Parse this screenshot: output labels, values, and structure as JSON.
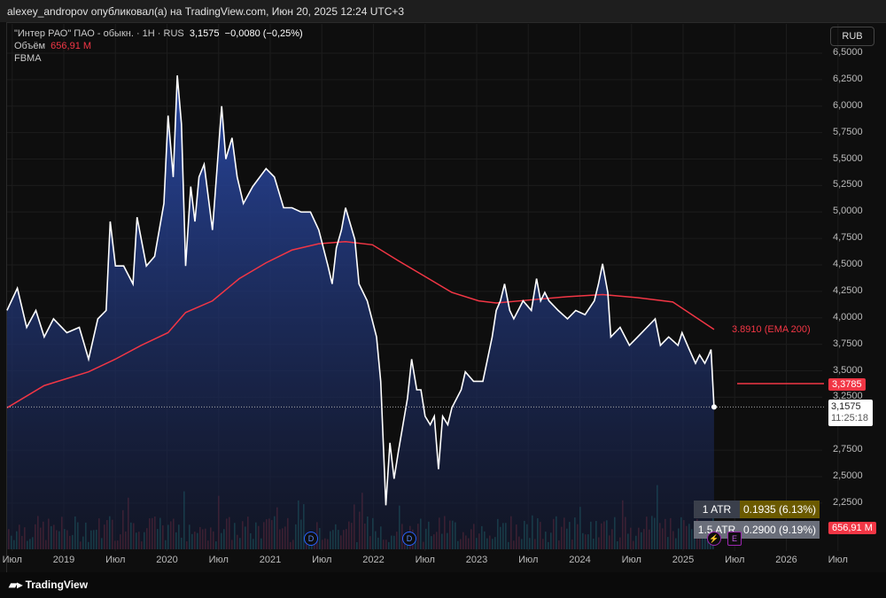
{
  "header": {
    "published": "alexey_andropov опубликовал(а) на TradingView.com, Июн 20, 2025 12:24 UTC+3"
  },
  "legend": {
    "symbol": "\"Интер РАО\" ПАО - обыкн. · 1H · RUS",
    "price": "3,1575",
    "change": "−0,0080 (−0,25%)",
    "volume_label": "Объём",
    "volume_value": "656,91 M",
    "indicator": "FBMA"
  },
  "currency": "RUB",
  "price_axis": [
    "6,5000",
    "6,2500",
    "6,0000",
    "5,7500",
    "5,5000",
    "5,2500",
    "5,0000",
    "4,7500",
    "4,5000",
    "4,2500",
    "4,0000",
    "3,7500",
    "3,5000",
    "3,2500",
    "2,7500",
    "2,5000",
    "2,2500"
  ],
  "time_axis": [
    "Июл",
    "2019",
    "Июл",
    "2020",
    "Июл",
    "2021",
    "Июл",
    "2022",
    "Июл",
    "2023",
    "Июл",
    "2024",
    "Июл",
    "2025",
    "Июл",
    "2026",
    "Июл"
  ],
  "tags": {
    "ema_label": "3.8910 (EMA 200)",
    "level": "3,3785",
    "last_price": "3,1575",
    "countdown": "11:25:18",
    "volume": "656,91 M"
  },
  "atr": {
    "row1_label": "1 ATR",
    "row1_value": "0.1935 (6.13%)",
    "row2_label": "1.5 ATR",
    "row2_value": "0.2900 (9.19%)"
  },
  "events": {
    "dividend": "D",
    "earnings": "E"
  },
  "footer": {
    "brand": "TradingView"
  },
  "colors": {
    "price_line": "#ffffff",
    "ema": "#f23645",
    "area_top": "#1f3a8a",
    "level": "#f23645"
  },
  "chart_data": {
    "type": "area",
    "title": "\"Интер РАО\" ПАО - обыкн. · 1H · RUS",
    "xlabel": "",
    "ylabel": "RUB",
    "ylim": [
      2.25,
      6.5
    ],
    "grid": true,
    "series": [
      {
        "name": "Price",
        "points": [
          [
            2018.45,
            4.07
          ],
          [
            2018.55,
            4.28
          ],
          [
            2018.64,
            3.91
          ],
          [
            2018.73,
            4.07
          ],
          [
            2018.81,
            3.82
          ],
          [
            2018.9,
            3.99
          ],
          [
            2019.03,
            3.86
          ],
          [
            2019.15,
            3.91
          ],
          [
            2019.24,
            3.61
          ],
          [
            2019.33,
            3.99
          ],
          [
            2019.41,
            4.07
          ],
          [
            2019.45,
            4.91
          ],
          [
            2019.5,
            4.49
          ],
          [
            2019.58,
            4.49
          ],
          [
            2019.67,
            4.32
          ],
          [
            2019.71,
            4.95
          ],
          [
            2019.8,
            4.49
          ],
          [
            2019.88,
            4.58
          ],
          [
            2019.97,
            5.08
          ],
          [
            2020.01,
            5.91
          ],
          [
            2020.06,
            5.33
          ],
          [
            2020.1,
            6.29
          ],
          [
            2020.14,
            5.83
          ],
          [
            2020.18,
            4.49
          ],
          [
            2020.23,
            5.24
          ],
          [
            2020.27,
            4.91
          ],
          [
            2020.31,
            5.33
          ],
          [
            2020.36,
            5.45
          ],
          [
            2020.44,
            4.83
          ],
          [
            2020.53,
            6.0
          ],
          [
            2020.57,
            5.5
          ],
          [
            2020.63,
            5.7
          ],
          [
            2020.68,
            5.33
          ],
          [
            2020.74,
            5.08
          ],
          [
            2020.83,
            5.24
          ],
          [
            2020.96,
            5.41
          ],
          [
            2021.04,
            5.33
          ],
          [
            2021.13,
            5.04
          ],
          [
            2021.21,
            5.04
          ],
          [
            2021.3,
            5.0
          ],
          [
            2021.39,
            5.0
          ],
          [
            2021.47,
            4.83
          ],
          [
            2021.56,
            4.49
          ],
          [
            2021.6,
            4.32
          ],
          [
            2021.64,
            4.66
          ],
          [
            2021.69,
            4.83
          ],
          [
            2021.73,
            5.04
          ],
          [
            2021.82,
            4.74
          ],
          [
            2021.86,
            4.32
          ],
          [
            2021.94,
            4.16
          ],
          [
            2022.03,
            3.82
          ],
          [
            2022.07,
            3.4
          ],
          [
            2022.12,
            2.23
          ],
          [
            2022.16,
            2.82
          ],
          [
            2022.2,
            2.48
          ],
          [
            2022.24,
            2.73
          ],
          [
            2022.33,
            3.24
          ],
          [
            2022.37,
            3.61
          ],
          [
            2022.42,
            3.32
          ],
          [
            2022.46,
            3.32
          ],
          [
            2022.5,
            3.07
          ],
          [
            2022.55,
            2.99
          ],
          [
            2022.59,
            3.07
          ],
          [
            2022.63,
            2.57
          ],
          [
            2022.67,
            3.07
          ],
          [
            2022.72,
            2.99
          ],
          [
            2022.76,
            3.15
          ],
          [
            2022.85,
            3.32
          ],
          [
            2022.89,
            3.49
          ],
          [
            2022.97,
            3.4
          ],
          [
            2023.06,
            3.4
          ],
          [
            2023.15,
            3.82
          ],
          [
            2023.19,
            4.07
          ],
          [
            2023.23,
            4.16
          ],
          [
            2023.27,
            4.32
          ],
          [
            2023.32,
            4.07
          ],
          [
            2023.36,
            3.99
          ],
          [
            2023.45,
            4.16
          ],
          [
            2023.53,
            4.07
          ],
          [
            2023.58,
            4.37
          ],
          [
            2023.62,
            4.16
          ],
          [
            2023.66,
            4.24
          ],
          [
            2023.7,
            4.16
          ],
          [
            2023.79,
            4.07
          ],
          [
            2023.88,
            3.99
          ],
          [
            2023.96,
            4.07
          ],
          [
            2024.05,
            4.03
          ],
          [
            2024.14,
            4.16
          ],
          [
            2024.18,
            4.32
          ],
          [
            2024.22,
            4.51
          ],
          [
            2024.27,
            4.24
          ],
          [
            2024.3,
            3.82
          ],
          [
            2024.39,
            3.91
          ],
          [
            2024.48,
            3.74
          ],
          [
            2024.56,
            3.82
          ],
          [
            2024.65,
            3.91
          ],
          [
            2024.73,
            3.99
          ],
          [
            2024.78,
            3.74
          ],
          [
            2024.86,
            3.82
          ],
          [
            2024.95,
            3.74
          ],
          [
            2024.99,
            3.86
          ],
          [
            2025.06,
            3.7
          ],
          [
            2025.12,
            3.57
          ],
          [
            2025.16,
            3.65
          ],
          [
            2025.21,
            3.57
          ],
          [
            2025.25,
            3.65
          ],
          [
            2025.27,
            3.7
          ],
          [
            2025.3,
            3.1575
          ]
        ]
      },
      {
        "name": "EMA 200",
        "points": [
          [
            2018.45,
            3.15
          ],
          [
            2018.81,
            3.36
          ],
          [
            2019.24,
            3.49
          ],
          [
            2019.5,
            3.61
          ],
          [
            2019.75,
            3.74
          ],
          [
            2020.01,
            3.86
          ],
          [
            2020.18,
            4.05
          ],
          [
            2020.44,
            4.16
          ],
          [
            2020.7,
            4.37
          ],
          [
            2020.96,
            4.52
          ],
          [
            2021.21,
            4.64
          ],
          [
            2021.47,
            4.7
          ],
          [
            2021.73,
            4.72
          ],
          [
            2021.99,
            4.69
          ],
          [
            2022.24,
            4.54
          ],
          [
            2022.5,
            4.39
          ],
          [
            2022.76,
            4.24
          ],
          [
            2023.02,
            4.16
          ],
          [
            2023.19,
            4.14
          ],
          [
            2023.53,
            4.17
          ],
          [
            2023.88,
            4.2
          ],
          [
            2024.22,
            4.22
          ],
          [
            2024.56,
            4.19
          ],
          [
            2024.9,
            4.15
          ],
          [
            2025.3,
            3.89
          ]
        ]
      }
    ],
    "annotations": [
      "3.8910 (EMA 200)",
      "3,3785",
      "3,1575",
      "1 ATR 0.1935 (6.13%)",
      "1.5 ATR 0.2900 (9.19%)"
    ]
  }
}
